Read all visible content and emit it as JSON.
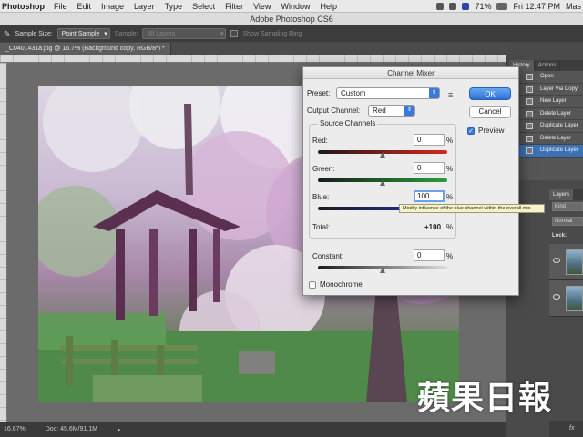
{
  "menubar": {
    "app": "Photoshop",
    "items": [
      "File",
      "Edit",
      "Image",
      "Layer",
      "Type",
      "Select",
      "Filter",
      "View",
      "Window",
      "Help"
    ],
    "battery": "71%",
    "day_time": "Fri 12:47 PM",
    "user": "Mas"
  },
  "window": {
    "title": "Adobe Photoshop CS6"
  },
  "options_bar": {
    "sample_size_label": "Sample Size:",
    "sample_size_value": "Point Sample",
    "sample_label": "Sample:",
    "sample_value": "All Layers",
    "show_sampling_ring": "Show Sampling Ring"
  },
  "document": {
    "tab_title": "_C0401431a.jpg @ 16.7% (Background copy, RGB/8*) *"
  },
  "statusbar": {
    "zoom": "16.67%",
    "doc": "Doc: 45.6M/91.1M"
  },
  "history": {
    "tabs": [
      "History",
      "Actions"
    ],
    "items": [
      "Open",
      "Layer Via Copy",
      "New Layer",
      "Delete Layer",
      "Duplicate Layer",
      "Delete Layer",
      "Duplicate Layer"
    ],
    "active_index": 6
  },
  "layers": {
    "tab": "Layers",
    "kind": "Kind",
    "mode": "Normal",
    "lock": "Lock:",
    "fx": "fx"
  },
  "dialog": {
    "title": "Channel Mixer",
    "preset_label": "Preset:",
    "preset_value": "Custom",
    "output_label": "Output Channel:",
    "output_value": "Red",
    "source_title": "Source Channels",
    "red_label": "Red:",
    "red_value": "0",
    "green_label": "Green:",
    "green_value": "0",
    "blue_label": "Blue:",
    "blue_value": "100",
    "pct": "%",
    "total_label": "Total:",
    "total_value": "+100",
    "constant_label": "Constant:",
    "constant_value": "0",
    "monochrome": "Monochrome",
    "ok": "OK",
    "cancel": "Cancel",
    "preview": "Preview",
    "tooltip": "Modify influence of the blue channel within the overall mix"
  },
  "watermark": "蘋果日報"
}
